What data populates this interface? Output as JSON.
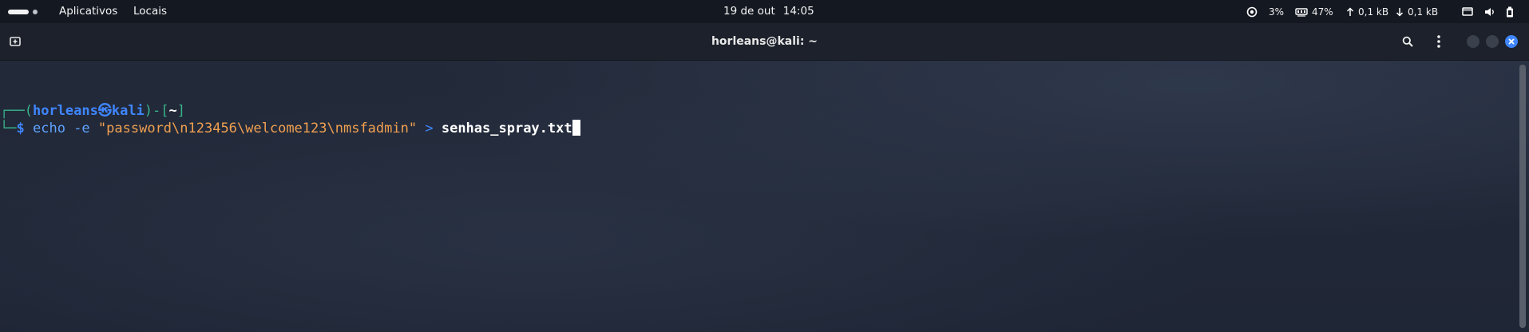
{
  "top_panel": {
    "apps_menu": "Aplicativos",
    "places_menu": "Locais",
    "date": "19 de out",
    "time": "14:05",
    "cpu": "3%",
    "memory": "47%",
    "upload": "0,1 kB",
    "download": "0,1 kB",
    "icons": [
      "cpu-icon",
      "memory-icon",
      "upload-arrow-icon",
      "download-arrow-icon",
      "display-icon",
      "volume-icon",
      "battery-icon"
    ]
  },
  "window": {
    "title": "horleans@kali: ~",
    "icons": [
      "new-tab-icon",
      "search-icon",
      "menu-icon",
      "minimize-icon",
      "maximize-icon",
      "close-icon"
    ],
    "accent_close": "#3f86ff"
  },
  "terminal": {
    "prompt_open": "┌──(",
    "user": "horleans",
    "host_symbol": "㉿",
    "host": "kali",
    "prompt_mid": ")-[",
    "cwd": "~",
    "prompt_close": "]",
    "prompt_line2": "└─",
    "prompt_char": "$",
    "command": "echo",
    "flag": "-e",
    "argument": "\"password\\n123456\\welcome123\\nmsfadmin\"",
    "redirect": ">",
    "target_file": "senhas_spray.txt"
  }
}
